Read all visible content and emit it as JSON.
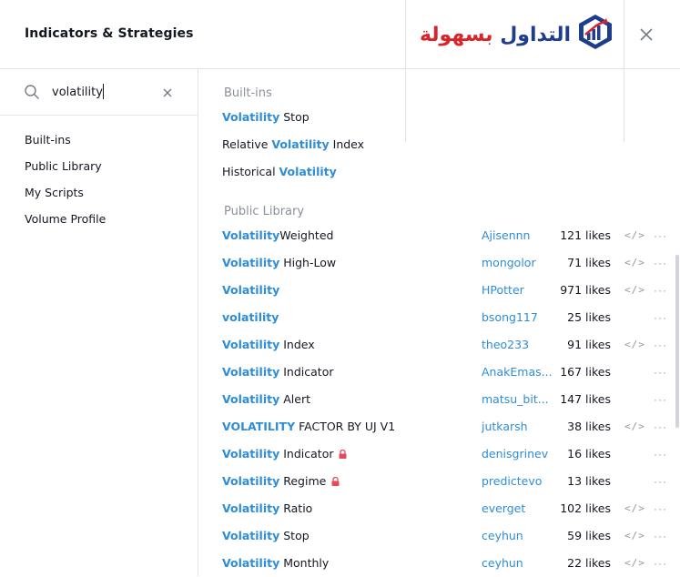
{
  "header": {
    "title": "Indicators & Strategies",
    "logo_text_red": "بسهولة",
    "logo_text_blue": "التداول",
    "brand_blue": "#1e3e8c",
    "brand_red": "#d6252b"
  },
  "search": {
    "value": "volatility",
    "placeholder": ""
  },
  "categories": [
    "Built-ins",
    "Public Library",
    "My Scripts",
    "Volume Profile"
  ],
  "sections": {
    "builtins": "Built-ins",
    "public": "Public Library"
  },
  "builtins": [
    {
      "hl": "Volatility",
      "pre": "",
      "post": " Stop"
    },
    {
      "hl": "Volatility",
      "pre": "Relative ",
      "post": " Index"
    },
    {
      "hl": "Volatility",
      "pre": "Historical ",
      "post": ""
    }
  ],
  "public": [
    {
      "hl": "Volatility",
      "post": "Weighted",
      "author": "Ajisennn",
      "likes": "121 likes",
      "code": true,
      "lock": false
    },
    {
      "hl": "Volatility",
      "post": " High-Low",
      "author": "mongolor",
      "likes": "71 likes",
      "code": true,
      "lock": false
    },
    {
      "hl": "Volatility",
      "post": "",
      "author": "HPotter",
      "likes": "971 likes",
      "code": true,
      "lock": false
    },
    {
      "hl": "volatility",
      "post": "",
      "author": "bsong117",
      "likes": "25 likes",
      "code": false,
      "lock": false
    },
    {
      "hl": "Volatility",
      "post": " Index",
      "author": "theo233",
      "likes": "91 likes",
      "code": true,
      "lock": false
    },
    {
      "hl": "Volatility",
      "post": " Indicator",
      "author": "AnakEmas...",
      "likes": "167 likes",
      "code": false,
      "lock": false
    },
    {
      "hl": "Volatility",
      "post": " Alert",
      "author": "matsu_bit...",
      "likes": "147 likes",
      "code": false,
      "lock": false
    },
    {
      "hl": "VOLATILITY",
      "post": " FACTOR BY UJ V1",
      "author": "jutkarsh",
      "likes": "38 likes",
      "code": true,
      "lock": false
    },
    {
      "hl": "Volatility",
      "post": " Indicator",
      "author": "denisgrinev",
      "likes": "16 likes",
      "code": false,
      "lock": true
    },
    {
      "hl": "Volatility",
      "post": " Regime",
      "author": "predictevo",
      "likes": "13 likes",
      "code": false,
      "lock": true
    },
    {
      "hl": "Volatility",
      "post": " Ratio",
      "author": "everget",
      "likes": "102 likes",
      "code": true,
      "lock": false
    },
    {
      "hl": "Volatility",
      "post": " Stop",
      "author": "ceyhun",
      "likes": "59 likes",
      "code": true,
      "lock": false
    },
    {
      "hl": "Volatility",
      "post": " Monthly",
      "author": "ceyhun",
      "likes": "22 likes",
      "code": true,
      "lock": false
    }
  ],
  "icons": {
    "code": "</>",
    "more": "···"
  },
  "colors": {
    "accent": "#2e8dd6",
    "muted": "#8a8f9c",
    "lock": "#e5495b"
  }
}
